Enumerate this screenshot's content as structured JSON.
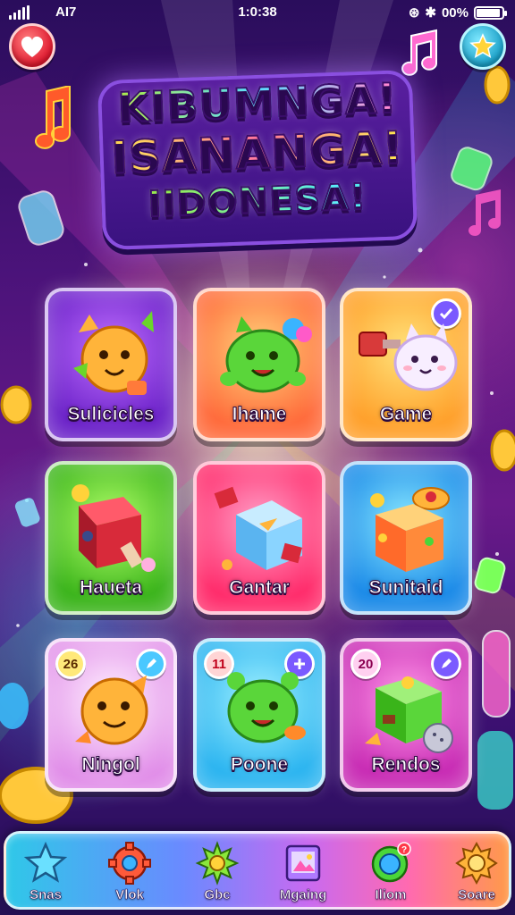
{
  "status_bar": {
    "carrier": "AI7",
    "time": "1:0:38",
    "battery": "00%",
    "signal_icon": "signal-icon",
    "battery_icon": "battery-icon"
  },
  "top_buttons": {
    "left_icon": "heart-icon",
    "right_icon": "star-icon"
  },
  "title": {
    "line1": "KIBUMNGA!",
    "line2": "ISANANGA!",
    "line3": "IIDONESA!"
  },
  "tiles": [
    {
      "label": "Sulicicles",
      "color": "#8a3ae0",
      "art": "orange-creature"
    },
    {
      "label": "Ihame",
      "color": "#ff8a4a",
      "art": "green-creature"
    },
    {
      "label": "Game",
      "color": "#ffb43a",
      "art": "white-cat",
      "action_icon": "check-icon"
    },
    {
      "label": "Haueta",
      "color": "#6ad62a",
      "art": "red-cube"
    },
    {
      "label": "Gantar",
      "color": "#ff4a8a",
      "art": "blue-cube"
    },
    {
      "label": "Sunitaid",
      "color": "#2ab4f0",
      "art": "orange-box"
    },
    {
      "label": "Ningol",
      "color": "#e89af0",
      "art": "orange-creature",
      "badge": "26",
      "action_icon": "pencil-icon"
    },
    {
      "label": "Poone",
      "color": "#3ac0f0",
      "art": "green-creature",
      "badge": "11",
      "action_icon": "plus-icon"
    },
    {
      "label": "Rendos",
      "color": "#e04ac8",
      "art": "green-cube",
      "badge": "20",
      "action_icon": "pencil-icon"
    }
  ],
  "nav": [
    {
      "label": "Snas",
      "icon": "star-icon"
    },
    {
      "label": "Vlok",
      "icon": "gear-icon"
    },
    {
      "label": "Gbc",
      "icon": "sun-icon"
    },
    {
      "label": "Mgaing",
      "icon": "picture-icon"
    },
    {
      "label": "Iliom",
      "icon": "globe-icon"
    },
    {
      "label": "Soare",
      "icon": "badge-icon"
    }
  ]
}
